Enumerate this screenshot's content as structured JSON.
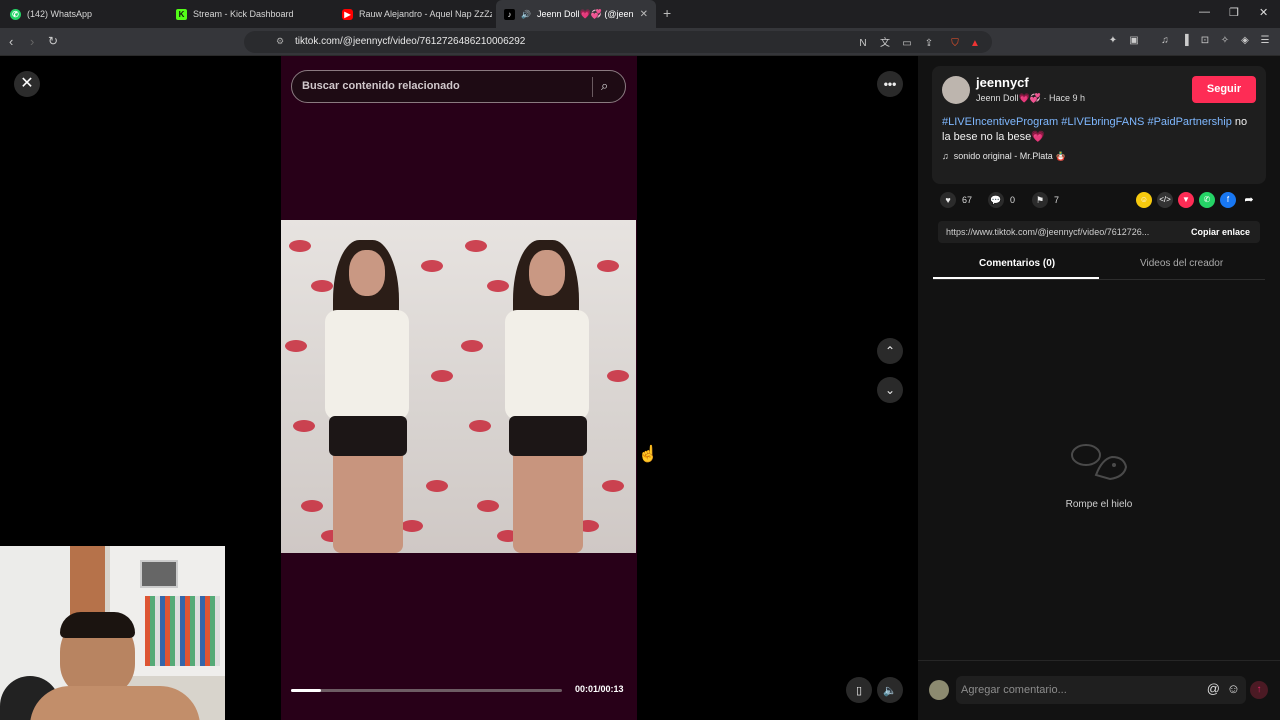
{
  "browser": {
    "tabs": [
      {
        "label": "(142) WhatsApp",
        "icon": "whatsapp-icon",
        "color": "#25d366"
      },
      {
        "label": "Stream - Kick Dashboard",
        "icon": "kick-icon",
        "color": "#53fc18"
      },
      {
        "label": "Rauw Alejandro - Aquel Nap ZzZz (Le",
        "icon": "youtube-icon",
        "color": "#ff0000"
      },
      {
        "label": "Jeenn Doll💗💞 (@jeennycf)",
        "icon": "tiktok-icon",
        "color": "#ffffff"
      }
    ],
    "url": "tiktok.com/@jeennycf/video/7612726486210006292"
  },
  "video": {
    "search_placeholder": "Buscar contenido relacionado",
    "time": "00:01/00:13",
    "progress": 0.11
  },
  "post": {
    "username": "jeennycf",
    "display_name": "Jeenn Doll💗💞",
    "age": "· Hace 9 h",
    "follow_label": "Seguir",
    "hashtags": [
      "#LIVEIncentiveProgram",
      "#LIVEbringFANS",
      "#PaidPartnership"
    ],
    "caption": " no la bese no la bese💗",
    "sound": "sonido original - Mr.Plata 🪆",
    "likes": "67",
    "comments": "0",
    "saves": "7",
    "link": "https://www.tiktok.com/@jeennycf/video/7612726...",
    "copy_label": "Copiar enlace",
    "tab_comments": "Comentarios (0)",
    "tab_creator": "Videos del creador",
    "empty_text": "Rompe el hielo",
    "comment_placeholder": "Agregar comentario...",
    "accent": "#fe2c55"
  }
}
